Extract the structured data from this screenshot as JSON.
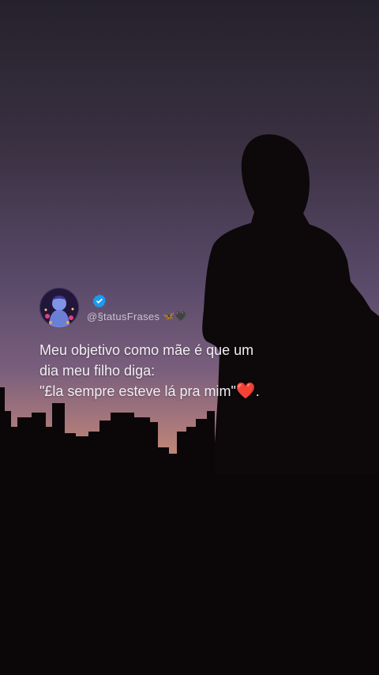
{
  "post": {
    "handle": "@§tatusFrases",
    "handle_emoji": "🦋🖤",
    "quote_line1": "Meu objetivo como mãe é que um",
    "quote_line2": "dia meu filho diga:",
    "quote_line3": "\"£la sempre esteve lá pra mim\"",
    "heart_emoji": "❤️",
    "quote_end": "."
  },
  "icons": {
    "verified": "verified-badge-icon",
    "avatar": "avatar-illustration"
  },
  "colors": {
    "sky_top": "#2a2431",
    "sky_mid": "#5c4a6c",
    "sky_horizon": "#c38a77",
    "silhouette": "#0b0709",
    "verified_blue": "#1d9bf0",
    "text": "#f2eef2"
  }
}
